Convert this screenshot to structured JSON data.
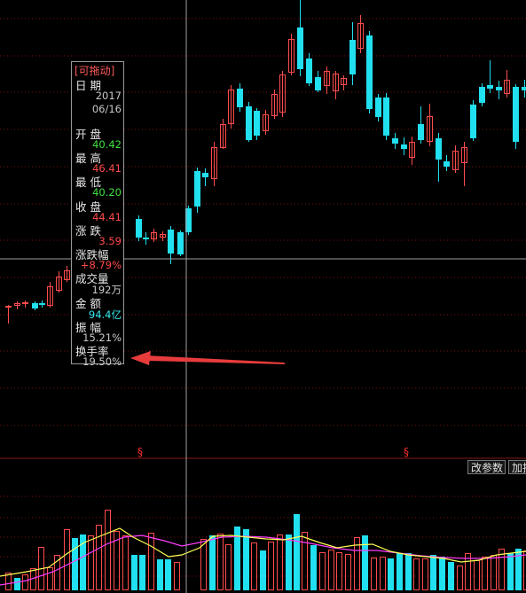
{
  "info_panel": {
    "title": "[可拖动]",
    "rows": [
      {
        "label": "日 期",
        "value": "2017",
        "color": "#c8c8c8"
      },
      {
        "label": "",
        "value": "06/16",
        "color": "#c8c8c8"
      },
      {
        "label": "开 盘",
        "value": "40.42",
        "color": "#3ee03e"
      },
      {
        "label": "最 高",
        "value": "46.41",
        "color": "#ff4a4a"
      },
      {
        "label": "最 低",
        "value": "40.20",
        "color": "#3ee03e"
      },
      {
        "label": "收 盘",
        "value": "44.41",
        "color": "#ff4a4a"
      },
      {
        "label": "涨 跌",
        "value": "3.59",
        "color": "#ff4a4a"
      },
      {
        "label": "涨跌幅",
        "value": "+8.79%",
        "color": "#ff4a4a"
      },
      {
        "label": "成交量",
        "value": "192万",
        "color": "#c8c8c8"
      },
      {
        "label": "金 额",
        "value": "94.4亿",
        "color": "#38e8f0"
      },
      {
        "label": "振 幅",
        "value": "15.21%",
        "color": "#c8c8c8"
      },
      {
        "label": "换手率",
        "value": "19.50%",
        "color": "#c8c8c8"
      }
    ]
  },
  "markers": {
    "dividend_symbol": "§"
  },
  "toolbar": {
    "params_button": "改参数",
    "add_button": "加指"
  },
  "colors": {
    "up": "#ff4c4c",
    "down": "#21e0f0",
    "ma_fast": "#ffff55",
    "ma_slow": "#ff3dff",
    "crosshair": "#a0a0a0",
    "grid": "#7a1010",
    "arrow": "#e83c3c",
    "background": "#000000"
  }
}
